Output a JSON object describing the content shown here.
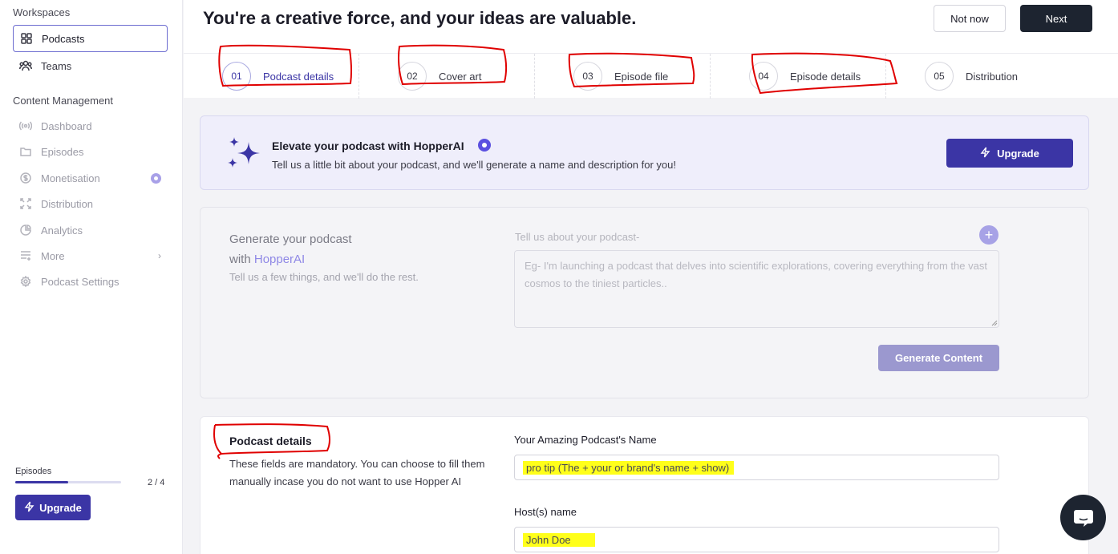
{
  "sidebar": {
    "workspaces_label": "Workspaces",
    "workspace_items": [
      {
        "label": "Podcasts",
        "icon": "grid-icon"
      },
      {
        "label": "Teams",
        "icon": "users-icon"
      }
    ],
    "content_label": "Content Management",
    "content_items": [
      {
        "label": "Dashboard",
        "icon": "broadcast-icon"
      },
      {
        "label": "Episodes",
        "icon": "folder-icon"
      },
      {
        "label": "Monetisation",
        "icon": "dollar-icon"
      },
      {
        "label": "Distribution",
        "icon": "expand-icon"
      },
      {
        "label": "Analytics",
        "icon": "pie-chart-icon"
      },
      {
        "label": "More",
        "icon": "list-icon"
      },
      {
        "label": "Podcast Settings",
        "icon": "gear-icon"
      }
    ],
    "episodes_label": "Episodes",
    "episodes_count": "2 / 4",
    "episodes_progress": 0.5,
    "upgrade_label": "Upgrade"
  },
  "header": {
    "title": "You're a creative force, and your ideas are valuable.",
    "not_now": "Not now",
    "next": "Next"
  },
  "steps": [
    {
      "num": "01",
      "label": "Podcast details"
    },
    {
      "num": "02",
      "label": "Cover art"
    },
    {
      "num": "03",
      "label": "Episode file"
    },
    {
      "num": "04",
      "label": "Episode details"
    },
    {
      "num": "05",
      "label": "Distribution"
    }
  ],
  "promo": {
    "title": "Elevate your podcast with HopperAI",
    "subtitle": "Tell us a little bit about your podcast, and we'll generate a name and description for you!",
    "button": "Upgrade"
  },
  "generate": {
    "title_line1": "Generate your podcast",
    "title_with": "with",
    "title_accent": "HopperAI",
    "subtitle": "Tell us a few things, and we'll do the rest.",
    "field_label": "Tell us about your podcast-",
    "placeholder": "Eg- I'm launching a podcast that delves into scientific explorations, covering everything from the vast cosmos to the tiniest particles..",
    "button": "Generate Content"
  },
  "details": {
    "title": "Podcast details",
    "subtitle": "These fields are mandatory. You can choose to fill them manually incase you do not want to use Hopper AI",
    "name_label": "Your Amazing Podcast's Name",
    "name_value": "pro tip (The + your or brand's name + show)",
    "host_label": "Host(s) name",
    "host_value": "John Doe"
  },
  "colors": {
    "accent": "#3b35a5",
    "annotation": "#e00000",
    "highlight": "#ffff1a"
  }
}
